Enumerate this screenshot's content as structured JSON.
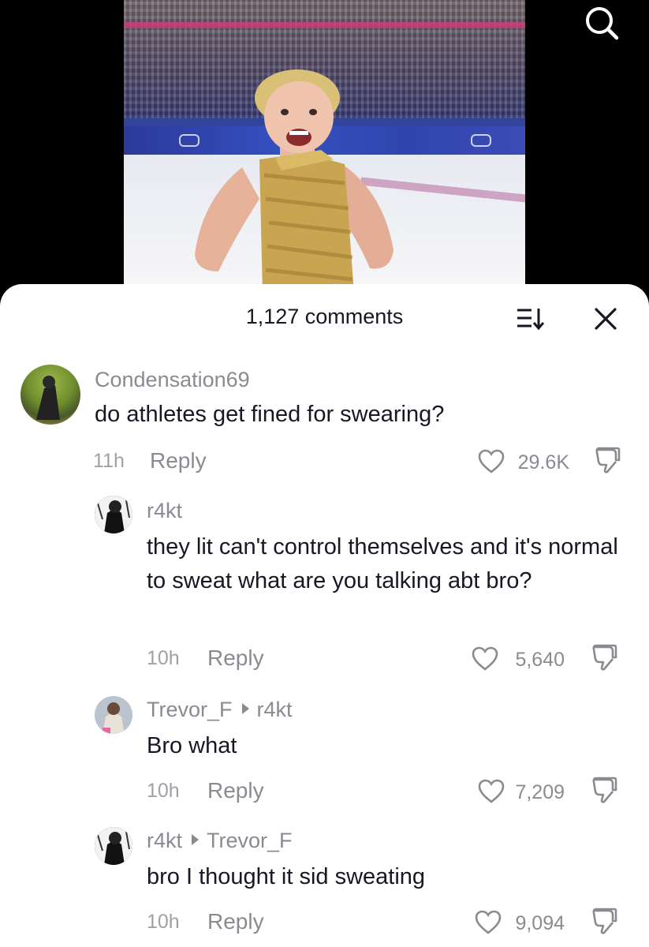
{
  "header": {
    "comment_count": "1,127 comments"
  },
  "icons": {
    "search": "search-icon",
    "sort": "sort-icon",
    "close": "close-icon",
    "like": "heart-icon",
    "dislike": "thumbs-down-icon"
  },
  "comments": [
    {
      "username": "Condensation69",
      "reply_to": "",
      "text": "do athletes get fined for swearing?",
      "time": "11h",
      "reply_label": "Reply",
      "likes": "29.6K"
    },
    {
      "username": "r4kt",
      "reply_to": "",
      "text": "they lit can't control themselves and it's normal to sweat what are you talking abt bro?",
      "time": "10h",
      "reply_label": "Reply",
      "likes": "5,640"
    },
    {
      "username": "Trevor_F",
      "reply_to": "r4kt",
      "text": "Bro what",
      "time": "10h",
      "reply_label": "Reply",
      "likes": "7,209"
    },
    {
      "username": "r4kt",
      "reply_to": "Trevor_F",
      "text": "bro I thought it sid sweating",
      "time": "10h",
      "reply_label": "Reply",
      "likes": "9,094"
    }
  ]
}
